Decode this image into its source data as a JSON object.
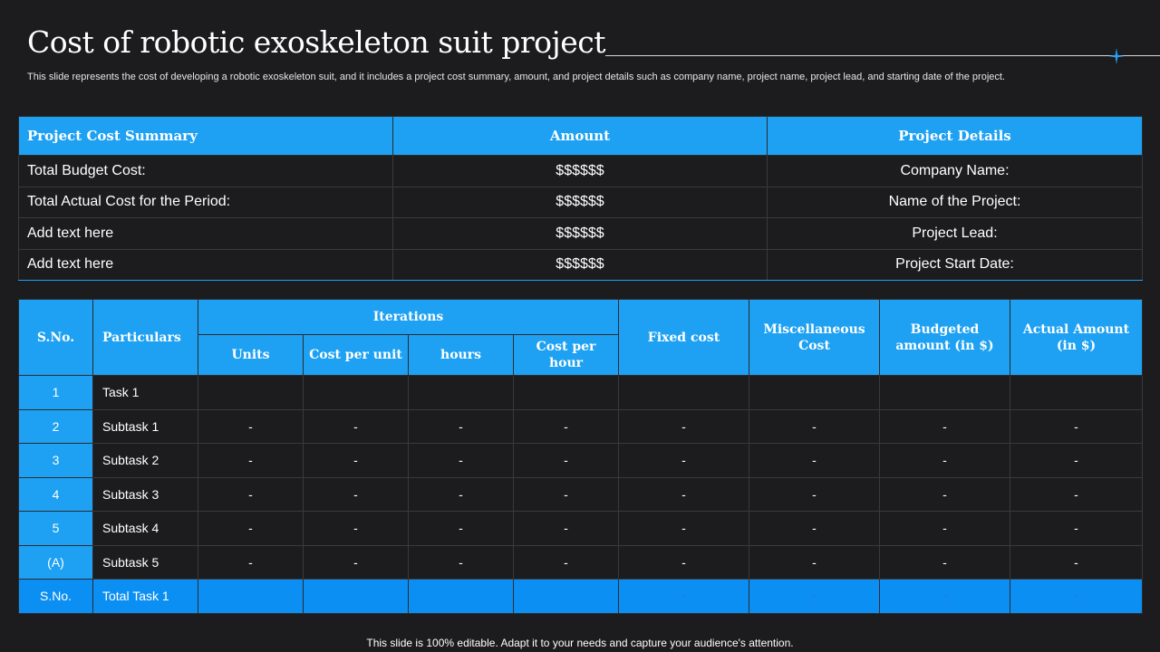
{
  "title": "Cost of robotic exoskeleton suit project",
  "subtitle": "This slide represents the cost of developing a robotic exoskeleton suit, and it includes a project cost summary, amount, and project details such as company name, project name, project lead, and starting date of the project.",
  "accent_color": "#1ea1f2",
  "decoration_icon": "sparkle-star-icon",
  "summary_table": {
    "headers": [
      "Project Cost Summary",
      "Amount",
      "Project Details"
    ],
    "rows": [
      [
        "Total Budget Cost:",
        "$$$$$$",
        "Company Name:"
      ],
      [
        "Total Actual Cost for the Period:",
        "$$$$$$",
        "Name of the Project:"
      ],
      [
        "Add text here",
        "$$$$$$",
        "Project Lead:"
      ],
      [
        "Add text here",
        "$$$$$$",
        "Project Start Date:"
      ]
    ]
  },
  "cost_table": {
    "headers": {
      "sno": "S.No.",
      "particulars": "Particulars",
      "iterations": "Iterations",
      "units": "Units",
      "cost_per_unit": "Cost per unit",
      "hours": "hours",
      "cost_per_hour": "Cost per hour",
      "fixed_cost": "Fixed cost",
      "misc_cost": "Miscellaneous Cost",
      "budgeted": "Budgeted amount (in $)",
      "actual": "Actual Amount (in $)"
    },
    "rows": [
      {
        "sno": "1",
        "particular": "Task 1",
        "values": [
          "",
          "",
          "",
          "",
          "",
          "",
          "",
          ""
        ]
      },
      {
        "sno": "2",
        "particular": "Subtask 1",
        "values": [
          "-",
          "-",
          "-",
          "-",
          "-",
          "-",
          "-",
          "-"
        ]
      },
      {
        "sno": "3",
        "particular": "Subtask 2",
        "values": [
          "-",
          "-",
          "-",
          "-",
          "-",
          "-",
          "-",
          "-"
        ]
      },
      {
        "sno": "4",
        "particular": "Subtask 3",
        "values": [
          "-",
          "-",
          "-",
          "-",
          "-",
          "-",
          "-",
          "-"
        ]
      },
      {
        "sno": "5",
        "particular": "Subtask 4",
        "values": [
          "-",
          "-",
          "-",
          "-",
          "-",
          "-",
          "-",
          "-"
        ]
      },
      {
        "sno": "(A)",
        "particular": "Subtask 5",
        "values": [
          "-",
          "-",
          "-",
          "-",
          "-",
          "-",
          "-",
          "-"
        ]
      }
    ],
    "total_row": {
      "sno": "S.No.",
      "particular": "Total Task 1",
      "values": [
        "",
        "",
        "",
        "",
        "-",
        "-",
        "-",
        "-"
      ]
    }
  },
  "footer": "This slide is 100% editable. Adapt it to your needs and capture your audience's attention."
}
